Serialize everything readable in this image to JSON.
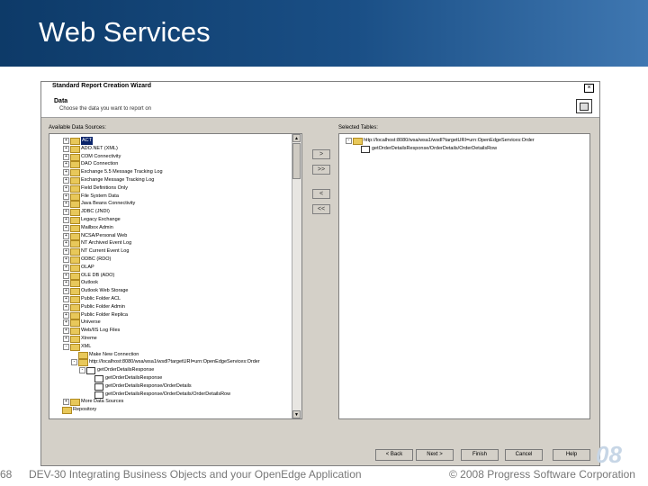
{
  "slide": {
    "title": "Web Services",
    "page_number": "68",
    "course": "DEV-30 Integrating Business Objects and your OpenEdge Application",
    "copyright": "© 2008 Progress Software Corporation",
    "logo_text": "08"
  },
  "wizard": {
    "title": "Standard Report Creation Wizard",
    "section": "Data",
    "subtitle": "Choose the data you want to report on",
    "available_label": "Available Data Sources:",
    "selected_label": "Selected Tables:",
    "buttons": {
      "back": "< Back",
      "next": "Next >",
      "finish": "Finish",
      "cancel": "Cancel",
      "help": "Help"
    },
    "move_buttons": [
      ">",
      ">>",
      "<",
      "<<"
    ],
    "available_items": [
      {
        "label": "ACT",
        "indent": 0,
        "expander": "+",
        "icon": "folder-icon",
        "selected": true
      },
      {
        "label": "ADO.NET (XML)",
        "indent": 0,
        "expander": "+",
        "icon": "folder-icon"
      },
      {
        "label": "COM Connectivity",
        "indent": 0,
        "expander": "+",
        "icon": "folder-icon"
      },
      {
        "label": "DAO Connection",
        "indent": 0,
        "expander": "+",
        "icon": "folder-icon"
      },
      {
        "label": "Exchange 5.5 Message Tracking Log",
        "indent": 0,
        "expander": "+",
        "icon": "folder-icon"
      },
      {
        "label": "Exchange Message Tracking Log",
        "indent": 0,
        "expander": "+",
        "icon": "folder-icon"
      },
      {
        "label": "Field Definitions Only",
        "indent": 0,
        "expander": "+",
        "icon": "folder-icon"
      },
      {
        "label": "File System Data",
        "indent": 0,
        "expander": "+",
        "icon": "folder-icon"
      },
      {
        "label": "Java Beans Connectivity",
        "indent": 0,
        "expander": "+",
        "icon": "folder-icon"
      },
      {
        "label": "JDBC (JNDI)",
        "indent": 0,
        "expander": "+",
        "icon": "folder-icon"
      },
      {
        "label": "Legacy Exchange",
        "indent": 0,
        "expander": "+",
        "icon": "folder-icon"
      },
      {
        "label": "Mailbox Admin",
        "indent": 0,
        "expander": "+",
        "icon": "folder-icon"
      },
      {
        "label": "NCSA/Personal Web",
        "indent": 0,
        "expander": "+",
        "icon": "folder-icon"
      },
      {
        "label": "NT Archived Event Log",
        "indent": 0,
        "expander": "+",
        "icon": "folder-icon"
      },
      {
        "label": "NT Current Event Log",
        "indent": 0,
        "expander": "+",
        "icon": "folder-icon"
      },
      {
        "label": "ODBC (RDO)",
        "indent": 0,
        "expander": "+",
        "icon": "folder-icon"
      },
      {
        "label": "OLAP",
        "indent": 0,
        "expander": "+",
        "icon": "folder-icon"
      },
      {
        "label": "OLE DB (ADO)",
        "indent": 0,
        "expander": "+",
        "icon": "folder-icon"
      },
      {
        "label": "Outlook",
        "indent": 0,
        "expander": "+",
        "icon": "folder-icon"
      },
      {
        "label": "Outlook Web Storage",
        "indent": 0,
        "expander": "+",
        "icon": "folder-icon"
      },
      {
        "label": "Public Folder ACL",
        "indent": 0,
        "expander": "+",
        "icon": "folder-icon"
      },
      {
        "label": "Public Folder Admin",
        "indent": 0,
        "expander": "+",
        "icon": "folder-icon"
      },
      {
        "label": "Public Folder Replica",
        "indent": 0,
        "expander": "+",
        "icon": "folder-icon"
      },
      {
        "label": "Universe",
        "indent": 0,
        "expander": "+",
        "icon": "folder-icon"
      },
      {
        "label": "Web/IIS Log Files",
        "indent": 0,
        "expander": "+",
        "icon": "folder-icon"
      },
      {
        "label": "Xtreme",
        "indent": 0,
        "expander": "+",
        "icon": "folder-icon"
      },
      {
        "label": "XML",
        "indent": 0,
        "expander": "-",
        "icon": "folder-icon"
      },
      {
        "label": "Make New Connection",
        "indent": 1,
        "expander": "",
        "icon": "folder-icon"
      },
      {
        "label": "http://localhost:8080/wsa/wsa1/wsdl?targetURI=urn:OpenEdgeServices:Order",
        "indent": 1,
        "expander": "-",
        "icon": "folder-icon"
      },
      {
        "label": "getOrderDetailsResponse",
        "indent": 2,
        "expander": "-",
        "icon": "table-icon"
      },
      {
        "label": "getOrderDetailsResponse",
        "indent": 3,
        "expander": "",
        "icon": "table-icon"
      },
      {
        "label": "getOrderDetailsResponse/OrderDetails",
        "indent": 3,
        "expander": "",
        "icon": "table-icon"
      },
      {
        "label": "getOrderDetailsResponse/OrderDetails/OrderDetailsRow",
        "indent": 3,
        "expander": "",
        "icon": "table-icon"
      },
      {
        "label": "More Data Sources",
        "indent": 0,
        "expander": "+",
        "icon": "folder-icon"
      },
      {
        "label": "Repository",
        "indent": -1,
        "expander": "",
        "icon": "folder-icon"
      }
    ],
    "selected_items": [
      {
        "label": "http://localhost:8080/wsa/wsa1/wsdl?targetURI=urn:OpenEdgeServices:Order",
        "indent": 0,
        "expander": "-",
        "icon": "folder-icon"
      },
      {
        "label": "getOrderDetailsResponse/OrderDetails/OrderDetailsRow",
        "indent": 1,
        "expander": "",
        "icon": "table-icon"
      }
    ]
  }
}
